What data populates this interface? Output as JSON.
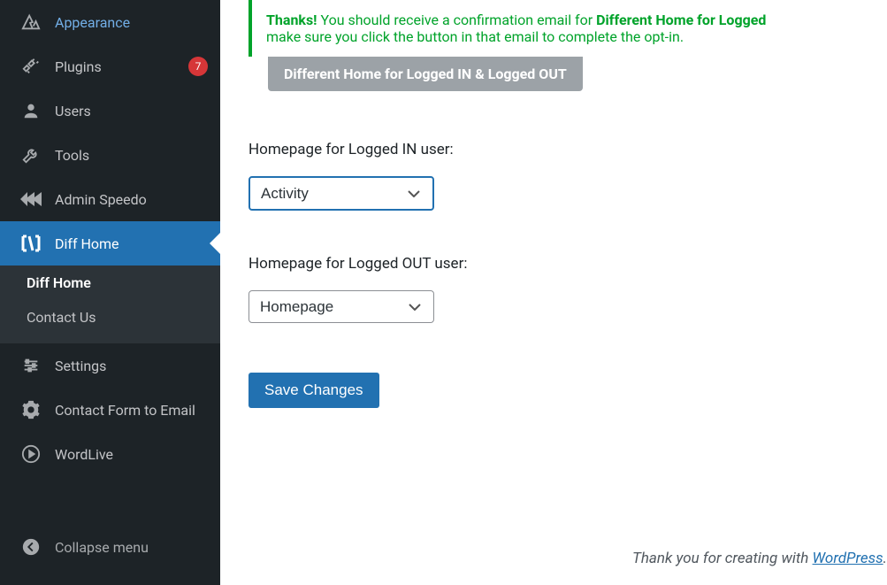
{
  "sidebar": {
    "items": [
      {
        "label": "Appearance",
        "icon": "appearance-icon"
      },
      {
        "label": "Plugins",
        "icon": "plugins-icon",
        "badge": "7"
      },
      {
        "label": "Users",
        "icon": "users-icon"
      },
      {
        "label": "Tools",
        "icon": "tools-icon"
      },
      {
        "label": "Admin Speedo",
        "icon": "speedo-icon"
      },
      {
        "label": "Diff Home",
        "icon": "diffhome-icon",
        "active": true
      },
      {
        "label": "Settings",
        "icon": "settings-icon"
      },
      {
        "label": "Contact Form to Email",
        "icon": "gear-icon"
      },
      {
        "label": "WordLive",
        "icon": "play-icon"
      }
    ],
    "submenu": [
      {
        "label": "Diff Home",
        "current": true
      },
      {
        "label": "Contact Us"
      }
    ],
    "collapse_label": "Collapse menu"
  },
  "notice": {
    "prefix": "Thanks!",
    "text_before": " You should receive a confirmation email for ",
    "highlight": "Different Home for Logged",
    "text_after": " make sure you click the button in that email to complete the opt-in."
  },
  "tab": {
    "label": "Different Home for Logged IN & Logged OUT"
  },
  "form": {
    "logged_in": {
      "label": "Homepage for Logged IN user:",
      "value": "Activity"
    },
    "logged_out": {
      "label": "Homepage for Logged OUT user:",
      "value": "Homepage"
    },
    "save_label": "Save Changes"
  },
  "footer": {
    "text": "Thank you for creating with ",
    "link_text": "WordPress",
    "period": "."
  }
}
